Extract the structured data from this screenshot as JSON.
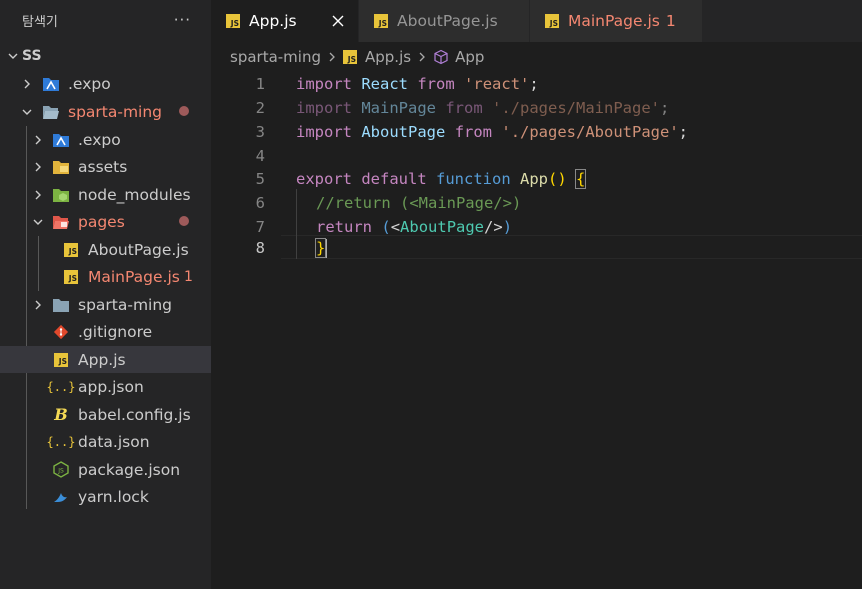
{
  "explorer": {
    "title": "탐색기",
    "more": "···",
    "items": [
      {
        "label": "SS",
        "type": "root"
      },
      {
        "label": ".expo",
        "type": "folder"
      },
      {
        "label": "sparta-ming",
        "type": "folder-open"
      },
      {
        "label": ".expo",
        "type": "folder"
      },
      {
        "label": "assets",
        "type": "folder"
      },
      {
        "label": "node_modules",
        "type": "folder"
      },
      {
        "label": "pages",
        "type": "folder-open"
      },
      {
        "label": "AboutPage.js",
        "type": "js"
      },
      {
        "label": "MainPage.js",
        "type": "js",
        "badge": "1"
      },
      {
        "label": "sparta-ming",
        "type": "folder"
      },
      {
        "label": ".gitignore",
        "type": "git"
      },
      {
        "label": "App.js",
        "type": "js"
      },
      {
        "label": "app.json",
        "type": "json"
      },
      {
        "label": "babel.config.js",
        "type": "babel"
      },
      {
        "label": "data.json",
        "type": "json"
      },
      {
        "label": "package.json",
        "type": "node"
      },
      {
        "label": "yarn.lock",
        "type": "yarn"
      }
    ]
  },
  "tabs": [
    {
      "label": "App.js",
      "icon": "JS",
      "active": true
    },
    {
      "label": "AboutPage.js",
      "icon": "JS"
    },
    {
      "label": "MainPage.js",
      "icon": "JS",
      "badge": "1"
    }
  ],
  "breadcrumb": {
    "folder": "sparta-ming",
    "file": "App.js",
    "symbol": "App"
  },
  "editor": {
    "line_numbers": [
      "1",
      "2",
      "3",
      "4",
      "5",
      "6",
      "7",
      "8"
    ],
    "line1": {
      "a": "import",
      "b": "React",
      "c": "from",
      "d": "'react'",
      "e": ";"
    },
    "line2": {
      "a": "import",
      "b": "MainPage",
      "c": "from",
      "d": "'./pages/MainPage'",
      "e": ";"
    },
    "line3": {
      "a": "import",
      "b": "AboutPage",
      "c": "from",
      "d": "'./pages/AboutPage'",
      "e": ";"
    },
    "line5": {
      "a": "export",
      "b": "default",
      "c": "function",
      "d": "App",
      "e": "()",
      "f": "{"
    },
    "line6": {
      "a": "//return (<MainPage/>)"
    },
    "line7": {
      "a": "return",
      "b": "(",
      "c": "<",
      "d": "AboutPage",
      "e": "/>",
      "f": ")"
    },
    "line8": {
      "a": "}"
    }
  },
  "colors": {
    "accent_error": "#f48771",
    "js_icon": "#e8c43a",
    "selection": "#37373d"
  }
}
